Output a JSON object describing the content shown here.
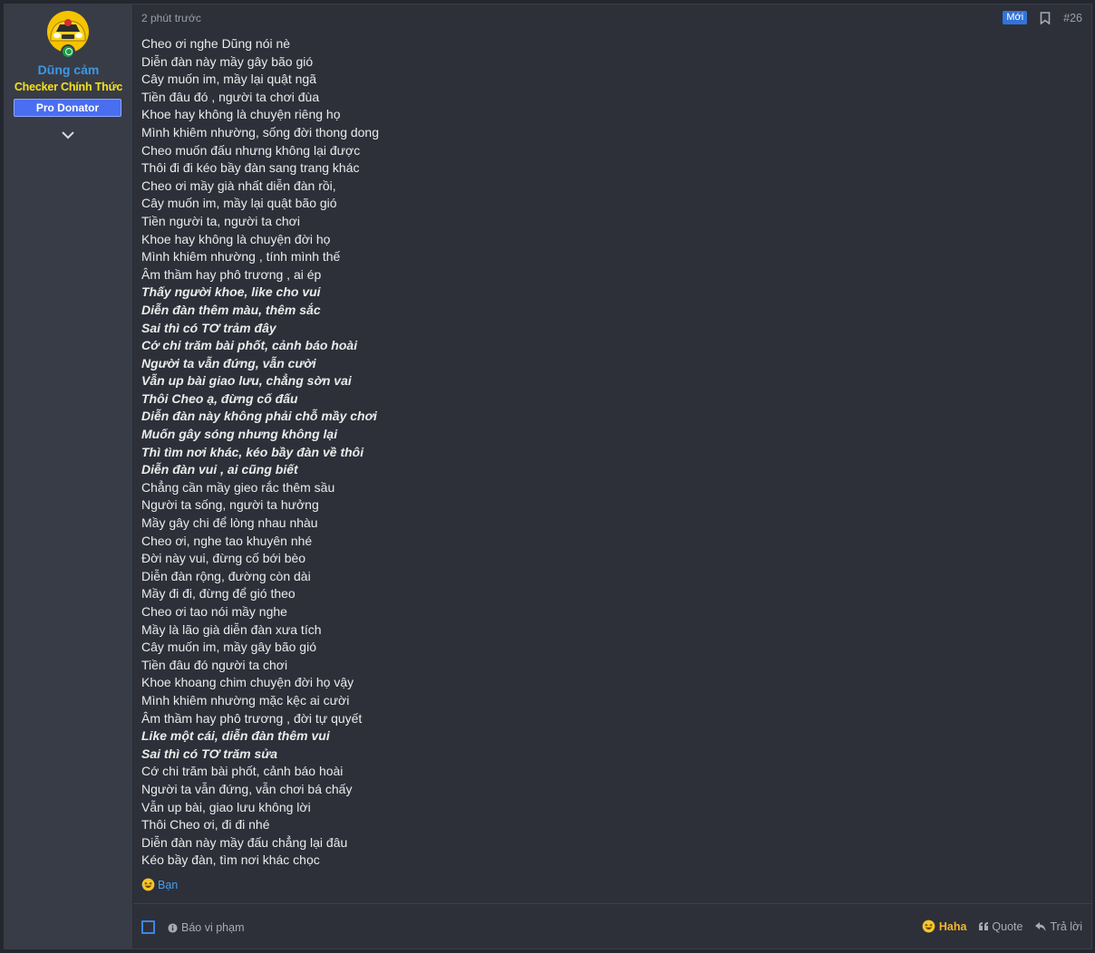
{
  "user": {
    "name": "Dũng cảm",
    "title": "Checker Chính Thức",
    "banner": "Pro Donator",
    "avatar_icon": "yellow-car-avatar",
    "status_icon": "online-icon"
  },
  "post": {
    "time": "2 phút trước",
    "new_badge": "Mới",
    "number": "#26",
    "lines": [
      {
        "text": "Cheo ơi nghe Dũng nói nè",
        "style": "normal"
      },
      {
        "text": "Diễn đàn này mầy gây bão gió",
        "style": "normal"
      },
      {
        "text": "Cây muốn im, mầy lại quật ngã",
        "style": "normal"
      },
      {
        "text": "Tiền đâu đó , người ta chơi đùa",
        "style": "normal"
      },
      {
        "text": "Khoe hay không là chuyện riêng họ",
        "style": "normal"
      },
      {
        "text": "Mình khiêm nhường, sống đời thong dong",
        "style": "normal"
      },
      {
        "text": "Cheo muốn đấu nhưng không lại được",
        "style": "normal"
      },
      {
        "text": "Thôi đi đi kéo bầy đàn sang trang khác",
        "style": "normal"
      },
      {
        "text": "Cheo ơi mầy già nhất diễn đàn rồi,",
        "style": "normal"
      },
      {
        "text": "Cây muốn im, mầy lại quật bão gió",
        "style": "normal"
      },
      {
        "text": "Tiền người ta, người ta chơi",
        "style": "normal"
      },
      {
        "text": "Khoe hay không là chuyện đời họ",
        "style": "normal"
      },
      {
        "text": "Mình khiêm nhường , tính mình thế",
        "style": "normal"
      },
      {
        "text": "Âm thầm hay phô trương , ai ép",
        "style": "normal"
      },
      {
        "text": "Thấy người khoe, like cho vui",
        "style": "em"
      },
      {
        "text": "Diễn đàn thêm màu, thêm sắc",
        "style": "em"
      },
      {
        "text": "Sai thì có TƠ trảm đây",
        "style": "em"
      },
      {
        "text": "Cớ chi trăm bài phốt, cảnh báo hoài",
        "style": "em"
      },
      {
        "text": "Người ta vẫn đứng, vẫn cười",
        "style": "em"
      },
      {
        "text": "Vẫn up bài giao lưu, chẳng sờn vai",
        "style": "em"
      },
      {
        "text": "Thôi Cheo ạ, đừng cố đấu",
        "style": "em"
      },
      {
        "text": "Diễn đàn này không phải chỗ mầy chơi",
        "style": "em"
      },
      {
        "text": "Muốn gây sóng nhưng không lại",
        "style": "em"
      },
      {
        "text": "Thì tìm nơi khác, kéo bầy đàn về thôi",
        "style": "em"
      },
      {
        "text": "Diễn đàn vui , ai cũng biết",
        "style": "em"
      },
      {
        "text": "Chẳng cần mầy gieo rắc thêm sầu",
        "style": "normal"
      },
      {
        "text": "Người ta sống, người ta hưởng",
        "style": "normal"
      },
      {
        "text": "Mầy gây chi để lòng nhau nhàu",
        "style": "normal"
      },
      {
        "text": "Cheo ơi, nghe tao khuyên nhé",
        "style": "normal"
      },
      {
        "text": "Đời này vui, đừng cố bới bèo",
        "style": "normal"
      },
      {
        "text": "Diễn đàn rộng, đường còn dài",
        "style": "normal"
      },
      {
        "text": "Mầy đi đi, đừng để gió theo",
        "style": "normal"
      },
      {
        "text": "Cheo ơi tao nói mầy nghe",
        "style": "normal"
      },
      {
        "text": "Mầy là lão già diễn đàn xưa tích",
        "style": "normal"
      },
      {
        "text": "Cây muốn im, mầy gây bão gió",
        "style": "normal"
      },
      {
        "text": "Tiền đâu đó người ta chơi",
        "style": "normal"
      },
      {
        "text": "Khoe khoang chim chuyện đời họ vậy",
        "style": "normal"
      },
      {
        "text": "Mình khiêm nhường mặc kệc ai cười",
        "style": "normal"
      },
      {
        "text": "Âm thầm hay phô trương , đời tự quyết",
        "style": "normal"
      },
      {
        "text": "Like một cái, diễn đàn thêm vui",
        "style": "em"
      },
      {
        "text": "Sai thì có TƠ trăm sửa",
        "style": "em"
      },
      {
        "text": "Cớ chi trăm bài phốt, cảnh báo hoài",
        "style": "normal"
      },
      {
        "text": "Người ta vẫn đứng, vẫn chơi bá chấy",
        "style": "normal"
      },
      {
        "text": "Vẫn up bài, giao lưu không lời",
        "style": "normal"
      },
      {
        "text": "Thôi Cheo ơi, đi đi nhé",
        "style": "normal"
      },
      {
        "text": "Diễn đàn này mầy đấu chẳng lại đâu",
        "style": "normal"
      },
      {
        "text": "Kéo bầy đàn, tìm nơi khác chọc",
        "style": "normal"
      }
    ]
  },
  "reactions": {
    "icon": "haha-emoji-icon",
    "who": "Bạn"
  },
  "footer": {
    "report_label": "Báo vi phạm",
    "haha_label": "Haha",
    "quote_label": "Quote",
    "reply_label": "Trả lời"
  },
  "colors": {
    "username": "#3c98e4",
    "title": "#f6e11c",
    "banner": "#4a6ef2",
    "new_badge": "#3473d8",
    "haha": "#f3b52d"
  }
}
